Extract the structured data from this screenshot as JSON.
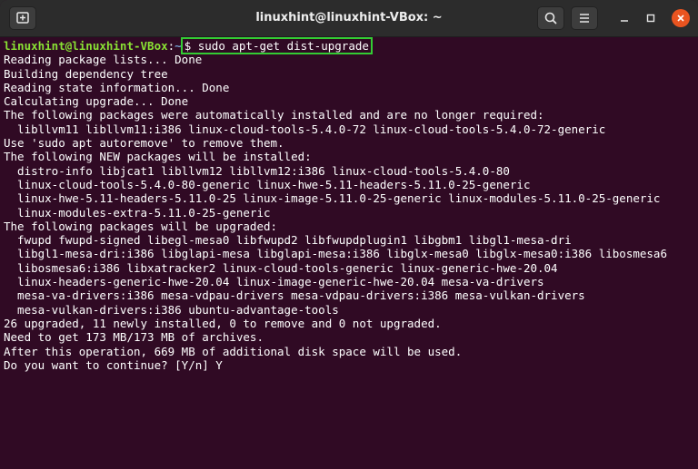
{
  "window": {
    "title": "linuxhint@linuxhint-VBox: ~"
  },
  "colors": {
    "terminal_bg": "#300a24",
    "titlebar_bg": "#2c2c2c",
    "prompt_user": "#8ae234",
    "prompt_path": "#729fcf",
    "highlight_box": "#33cc33",
    "close_button": "#e95420"
  },
  "icons": {
    "new_tab": "new-tab-icon",
    "search": "search-icon",
    "menu": "hamburger-menu-icon",
    "minimize": "minimize-icon",
    "maximize": "maximize-icon",
    "close": "close-icon"
  },
  "prompt": {
    "user_host": "linuxhint@linuxhint-VBox",
    "separator": ":",
    "path": "~",
    "symbol": "$",
    "command": "sudo apt-get dist-upgrade"
  },
  "output": [
    "Reading package lists... Done",
    "Building dependency tree",
    "Reading state information... Done",
    "Calculating upgrade... Done",
    "The following packages were automatically installed and are no longer required:",
    "  libllvm11 libllvm11:i386 linux-cloud-tools-5.4.0-72 linux-cloud-tools-5.4.0-72-generic",
    "Use 'sudo apt autoremove' to remove them.",
    "The following NEW packages will be installed:",
    "  distro-info libjcat1 libllvm12 libllvm12:i386 linux-cloud-tools-5.4.0-80",
    "  linux-cloud-tools-5.4.0-80-generic linux-hwe-5.11-headers-5.11.0-25-generic",
    "  linux-hwe-5.11-headers-5.11.0-25 linux-image-5.11.0-25-generic linux-modules-5.11.0-25-generic",
    "  linux-modules-extra-5.11.0-25-generic",
    "The following packages will be upgraded:",
    "  fwupd fwupd-signed libegl-mesa0 libfwupd2 libfwupdplugin1 libgbm1 libgl1-mesa-dri",
    "  libgl1-mesa-dri:i386 libglapi-mesa libglapi-mesa:i386 libglx-mesa0 libglx-mesa0:i386 libosmesa6",
    "  libosmesa6:i386 libxatracker2 linux-cloud-tools-generic linux-generic-hwe-20.04",
    "  linux-headers-generic-hwe-20.04 linux-image-generic-hwe-20.04 mesa-va-drivers",
    "  mesa-va-drivers:i386 mesa-vdpau-drivers mesa-vdpau-drivers:i386 mesa-vulkan-drivers",
    "  mesa-vulkan-drivers:i386 ubuntu-advantage-tools",
    "26 upgraded, 11 newly installed, 0 to remove and 0 not upgraded.",
    "Need to get 173 MB/173 MB of archives.",
    "After this operation, 669 MB of additional disk space will be used.",
    "Do you want to continue? [Y/n] Y"
  ]
}
